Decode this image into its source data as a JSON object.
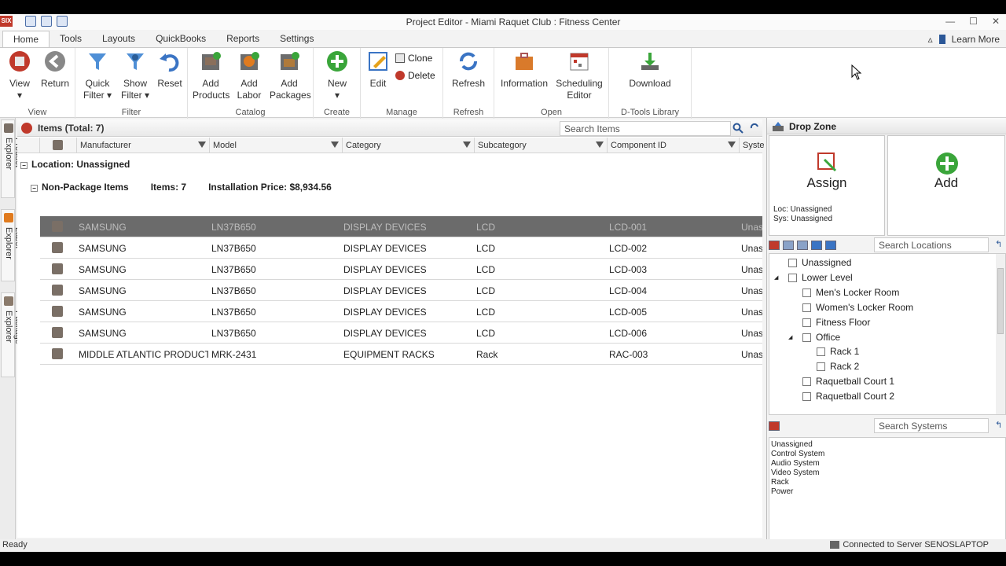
{
  "window": {
    "title": "Project Editor - Miami Raquet Club : Fitness Center",
    "app_badge": "SIX",
    "minimize": "—",
    "maximize": "☐",
    "close": "✕"
  },
  "tabs": [
    "Home",
    "Tools",
    "Layouts",
    "QuickBooks",
    "Reports",
    "Settings"
  ],
  "learn_more": "Learn More",
  "ribbon": {
    "groups": {
      "view": "View",
      "filter": "Filter",
      "catalog": "Catalog",
      "create": "Create",
      "manage": "Manage",
      "refresh": "Refresh",
      "open": "Open",
      "dtools": "D-Tools Library"
    },
    "buttons": {
      "view": "View",
      "return": "Return",
      "quick_filter_1": "Quick",
      "quick_filter_2": "Filter ▾",
      "show_filter_1": "Show",
      "show_filter_2": "Filter ▾",
      "reset": "Reset",
      "add_products_1": "Add",
      "add_products_2": "Products",
      "add_labor_1": "Add",
      "add_labor_2": "Labor",
      "add_packages_1": "Add",
      "add_packages_2": "Packages",
      "new": "New",
      "edit": "Edit",
      "clone": "Clone",
      "delete": "Delete",
      "refresh": "Refresh",
      "information": "Information",
      "scheduling_1": "Scheduling",
      "scheduling_2": "Editor",
      "download": "Download"
    }
  },
  "side_tabs": [
    "Product Explorer",
    "Labor Explorer",
    "Package Explorer"
  ],
  "items": {
    "header": "Items (Total: 7)",
    "search_placeholder": "Search Items",
    "columns": [
      "Manufacturer",
      "Model",
      "Category",
      "Subcategory",
      "Component ID",
      "Syste"
    ],
    "location": "Location: Unassigned",
    "package_group": "Non-Package Items",
    "package_count": "Items: 7",
    "installation_price": "Installation Price: $8,934.56",
    "rows": [
      {
        "manufacturer": "SAMSUNG",
        "model": "LN37B650",
        "category": "DISPLAY DEVICES",
        "subcategory": "LCD",
        "component": "LCD-001",
        "system": "Unas"
      },
      {
        "manufacturer": "SAMSUNG",
        "model": "LN37B650",
        "category": "DISPLAY DEVICES",
        "subcategory": "LCD",
        "component": "LCD-002",
        "system": "Unas"
      },
      {
        "manufacturer": "SAMSUNG",
        "model": "LN37B650",
        "category": "DISPLAY DEVICES",
        "subcategory": "LCD",
        "component": "LCD-003",
        "system": "Unas"
      },
      {
        "manufacturer": "SAMSUNG",
        "model": "LN37B650",
        "category": "DISPLAY DEVICES",
        "subcategory": "LCD",
        "component": "LCD-004",
        "system": "Unas"
      },
      {
        "manufacturer": "SAMSUNG",
        "model": "LN37B650",
        "category": "DISPLAY DEVICES",
        "subcategory": "LCD",
        "component": "LCD-005",
        "system": "Unas"
      },
      {
        "manufacturer": "SAMSUNG",
        "model": "LN37B650",
        "category": "DISPLAY DEVICES",
        "subcategory": "LCD",
        "component": "LCD-006",
        "system": "Unas"
      },
      {
        "manufacturer": "MIDDLE ATLANTIC PRODUCTS",
        "model": "MRK-2431",
        "category": "EQUIPMENT RACKS",
        "subcategory": "Rack",
        "component": "RAC-003",
        "system": "Unas"
      }
    ]
  },
  "drop_zone": {
    "title": "Drop Zone",
    "assign": "Assign",
    "add": "Add",
    "loc": "Loc: Unassigned",
    "sys": "Sys: Unassigned"
  },
  "locations": {
    "search_placeholder": "Search Locations",
    "tree": [
      {
        "label": "Unassigned",
        "level": 0,
        "expander": ""
      },
      {
        "label": "Lower Level",
        "level": 0,
        "expander": "◢"
      },
      {
        "label": "Men's Locker Room",
        "level": 1,
        "expander": ""
      },
      {
        "label": "Women's Locker Room",
        "level": 1,
        "expander": ""
      },
      {
        "label": "Fitness Floor",
        "level": 1,
        "expander": ""
      },
      {
        "label": "Office",
        "level": 1,
        "expander": "◢"
      },
      {
        "label": "Rack 1",
        "level": 2,
        "expander": ""
      },
      {
        "label": "Rack 2",
        "level": 2,
        "expander": ""
      },
      {
        "label": "Raquetball Court 1",
        "level": 1,
        "expander": ""
      },
      {
        "label": "Raquetball Court 2",
        "level": 1,
        "expander": ""
      }
    ]
  },
  "systems": {
    "search_placeholder": "Search Systems",
    "list": [
      "Unassigned",
      "Control System",
      "Audio System",
      "Video System",
      "Rack",
      "Power"
    ]
  },
  "status": {
    "left": "Ready",
    "right": "Connected to Server SENOSLAPTOP"
  }
}
